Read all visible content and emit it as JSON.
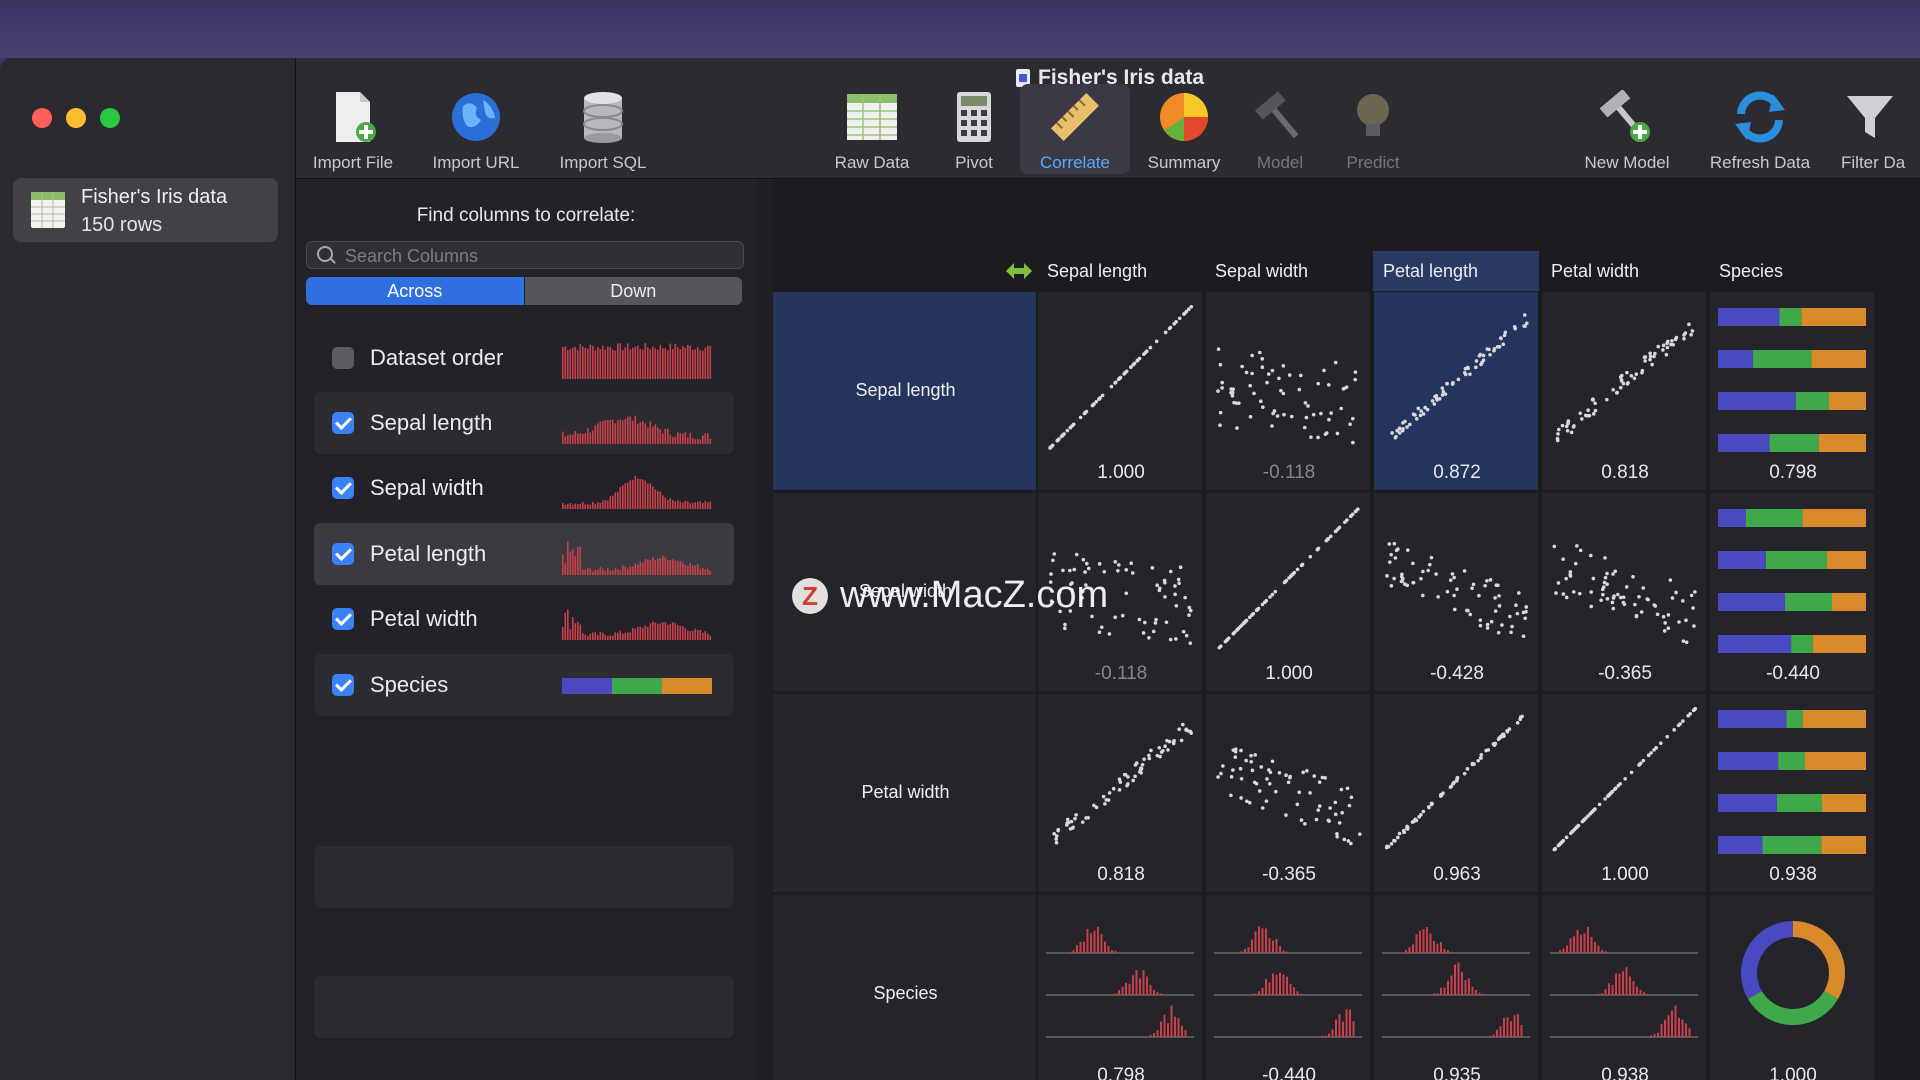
{
  "window": {
    "title": "Fisher's Iris data"
  },
  "sidebar": {
    "dataset": {
      "title": "Fisher's Iris data",
      "rows": "150 rows"
    }
  },
  "toolbar": {
    "items": [
      {
        "label": "Import File",
        "icon": "import-file-icon",
        "enabled": true
      },
      {
        "label": "Import URL",
        "icon": "globe-icon",
        "enabled": true
      },
      {
        "label": "Import SQL",
        "icon": "database-icon",
        "enabled": true
      },
      {
        "label": "Raw Data",
        "icon": "table-icon",
        "enabled": true
      },
      {
        "label": "Pivot",
        "icon": "calculator-icon",
        "enabled": true
      },
      {
        "label": "Correlate",
        "icon": "ruler-icon",
        "enabled": true,
        "active": true
      },
      {
        "label": "Summary",
        "icon": "pie-chart-icon",
        "enabled": true
      },
      {
        "label": "Model",
        "icon": "hammer-icon",
        "enabled": false
      },
      {
        "label": "Predict",
        "icon": "lightbulb-icon",
        "enabled": false
      },
      {
        "label": "New Model",
        "icon": "new-model-icon",
        "enabled": true
      },
      {
        "label": "Refresh Data",
        "icon": "refresh-icon",
        "enabled": true
      },
      {
        "label": "Filter Da",
        "icon": "funnel-icon",
        "enabled": true
      }
    ]
  },
  "panel": {
    "find_label": "Find columns to correlate:",
    "search_placeholder": "Search Columns",
    "segments": {
      "across": "Across",
      "down": "Down",
      "selected": "Across"
    },
    "columns": [
      {
        "name": "Dataset order",
        "checked": false
      },
      {
        "name": "Sepal length",
        "checked": true
      },
      {
        "name": "Sepal width",
        "checked": true
      },
      {
        "name": "Petal length",
        "checked": true,
        "selected": true
      },
      {
        "name": "Petal width",
        "checked": true
      },
      {
        "name": "Species",
        "checked": true
      }
    ]
  },
  "matrix": {
    "col_headers": [
      "Sepal length",
      "Sepal width",
      "Petal length",
      "Petal width",
      "Species"
    ],
    "highlight_col": "Petal length",
    "rows": [
      {
        "label": "Sepal length",
        "values": [
          "1.000",
          "-0.118",
          "0.872",
          "0.818",
          "0.798"
        ]
      },
      {
        "label": "Sepal width",
        "values": [
          "-0.118",
          "1.000",
          "-0.428",
          "-0.365",
          "-0.440"
        ]
      },
      {
        "label": "Petal width",
        "values": [
          "0.818",
          "-0.365",
          "0.963",
          "1.000",
          "0.938"
        ]
      },
      {
        "label": "Species",
        "values": [
          "0.798",
          "-0.440",
          "0.935",
          "0.938",
          "1.000"
        ]
      }
    ]
  },
  "colors": {
    "accent": "#3b82f6",
    "spark_red": "#c9404a",
    "species_blue": "#4a4ac0",
    "species_green": "#3ea84a",
    "species_orange": "#d98a2a",
    "highlight": "#24345c"
  },
  "watermark": {
    "text": "www.MacZ.com",
    "badge": "Z"
  }
}
